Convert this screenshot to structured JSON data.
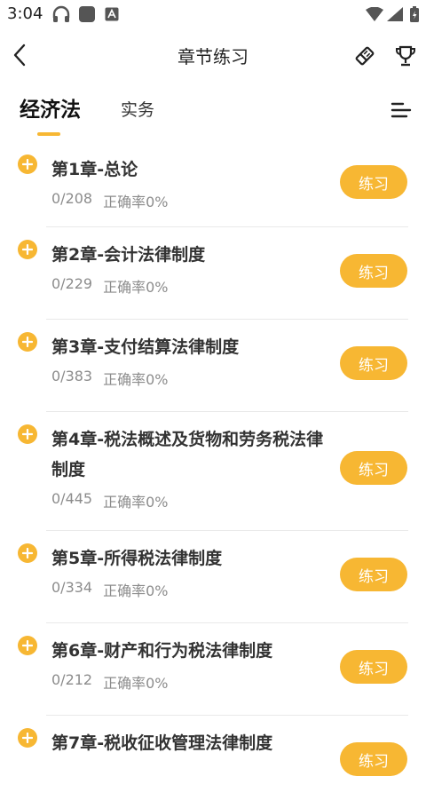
{
  "status_bar": {
    "time": "3:04"
  },
  "header": {
    "title": "章节练习"
  },
  "tabs": [
    {
      "label": "经济法",
      "active": true
    },
    {
      "label": "实务",
      "active": false
    }
  ],
  "chapters": [
    {
      "title": "第1章-总论",
      "progress": "0/208",
      "accuracy": "正确率0%",
      "button": "练习"
    },
    {
      "title": "第2章-会计法律制度",
      "progress": "0/229",
      "accuracy": "正确率0%",
      "button": "练习"
    },
    {
      "title": "第3章-支付结算法律制度",
      "progress": "0/383",
      "accuracy": "正确率0%",
      "button": "练习"
    },
    {
      "title": "第4章-税法概述及货物和劳务税法律制度",
      "progress": "0/445",
      "accuracy": "正确率0%",
      "button": "练习"
    },
    {
      "title": "第5章-所得税法律制度",
      "progress": "0/334",
      "accuracy": "正确率0%",
      "button": "练习"
    },
    {
      "title": "第6章-财产和行为税法律制度",
      "progress": "0/212",
      "accuracy": "正确率0%",
      "button": "练习"
    },
    {
      "title": "第7章-税收征收管理法律制度",
      "progress": "",
      "accuracy": "",
      "button": "练习"
    }
  ],
  "colors": {
    "accent": "#f7b733",
    "text": "#333333",
    "muted": "#8c8c8c"
  }
}
